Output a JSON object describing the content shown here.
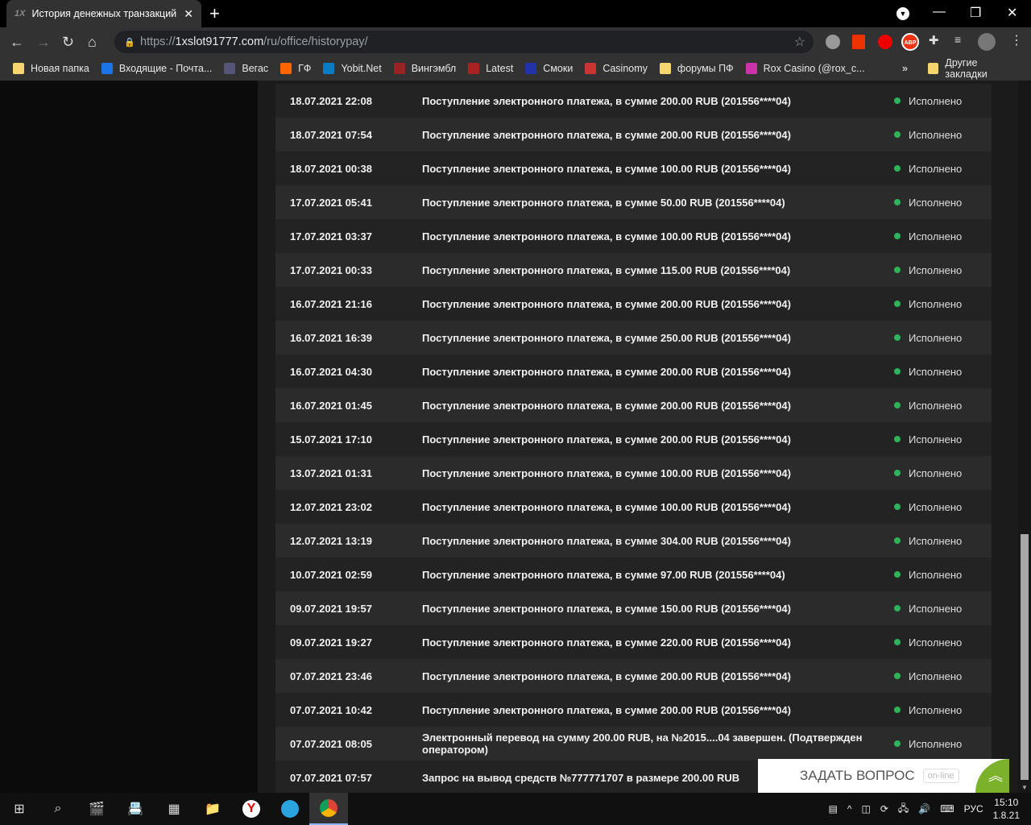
{
  "browser": {
    "tab_title": "История денежных транзакций",
    "tab_favicon": "1X",
    "url_prefix": "https://",
    "url_host": "1xslot91777.com",
    "url_path": "/ru/office/historypay/",
    "bookmarks": [
      "Новая папка",
      "Входящие - Почта...",
      "Вегас",
      "ГФ",
      "Yobit.Net",
      "Вингэмбл",
      "Latest",
      "Смоки",
      "Casinomy",
      "форумы ПФ",
      "Rox Casino (@rox_c..."
    ],
    "bookmark_overflow": "»",
    "other_bookmarks": "Другие закладки",
    "abp": "ABP"
  },
  "transactions": [
    {
      "date": "18.07.2021 22:08",
      "text": "Поступление электронного платежа, в сумме 200.00 RUB (201556****04)",
      "status": "Исполнено"
    },
    {
      "date": "18.07.2021 07:54",
      "text": "Поступление электронного платежа, в сумме 200.00 RUB (201556****04)",
      "status": "Исполнено"
    },
    {
      "date": "18.07.2021 00:38",
      "text": "Поступление электронного платежа, в сумме 100.00 RUB (201556****04)",
      "status": "Исполнено"
    },
    {
      "date": "17.07.2021 05:41",
      "text": "Поступление электронного платежа, в сумме 50.00 RUB (201556****04)",
      "status": "Исполнено"
    },
    {
      "date": "17.07.2021 03:37",
      "text": "Поступление электронного платежа, в сумме 100.00 RUB (201556****04)",
      "status": "Исполнено"
    },
    {
      "date": "17.07.2021 00:33",
      "text": "Поступление электронного платежа, в сумме 115.00 RUB (201556****04)",
      "status": "Исполнено"
    },
    {
      "date": "16.07.2021 21:16",
      "text": "Поступление электронного платежа, в сумме 200.00 RUB (201556****04)",
      "status": "Исполнено"
    },
    {
      "date": "16.07.2021 16:39",
      "text": "Поступление электронного платежа, в сумме 250.00 RUB (201556****04)",
      "status": "Исполнено"
    },
    {
      "date": "16.07.2021 04:30",
      "text": "Поступление электронного платежа, в сумме 200.00 RUB (201556****04)",
      "status": "Исполнено"
    },
    {
      "date": "16.07.2021 01:45",
      "text": "Поступление электронного платежа, в сумме 200.00 RUB (201556****04)",
      "status": "Исполнено"
    },
    {
      "date": "15.07.2021 17:10",
      "text": "Поступление электронного платежа, в сумме 200.00 RUB (201556****04)",
      "status": "Исполнено"
    },
    {
      "date": "13.07.2021 01:31",
      "text": "Поступление электронного платежа, в сумме 100.00 RUB (201556****04)",
      "status": "Исполнено"
    },
    {
      "date": "12.07.2021 23:02",
      "text": "Поступление электронного платежа, в сумме 100.00 RUB (201556****04)",
      "status": "Исполнено"
    },
    {
      "date": "12.07.2021 13:19",
      "text": "Поступление электронного платежа, в сумме 304.00 RUB (201556****04)",
      "status": "Исполнено"
    },
    {
      "date": "10.07.2021 02:59",
      "text": "Поступление электронного платежа, в сумме 97.00 RUB (201556****04)",
      "status": "Исполнено"
    },
    {
      "date": "09.07.2021 19:57",
      "text": "Поступление электронного платежа, в сумме 150.00 RUB (201556****04)",
      "status": "Исполнено"
    },
    {
      "date": "09.07.2021 19:27",
      "text": "Поступление электронного платежа, в сумме 220.00 RUB (201556****04)",
      "status": "Исполнено"
    },
    {
      "date": "07.07.2021 23:46",
      "text": "Поступление электронного платежа, в сумме 200.00 RUB (201556****04)",
      "status": "Исполнено"
    },
    {
      "date": "07.07.2021 10:42",
      "text": "Поступление электронного платежа, в сумме 200.00 RUB (201556****04)",
      "status": "Исполнено"
    },
    {
      "date": "07.07.2021 08:05",
      "text": "Электронный перевод на сумму 200.00 RUB, на №2015....04 завершен. (Подтвержден оператором)",
      "status": "Исполнено"
    },
    {
      "date": "07.07.2021 07:57",
      "text": "Запрос на вывод средств №777771707 в размере 200.00 RUB",
      "status": ""
    }
  ],
  "chat": {
    "label": "ЗАДАТЬ ВОПРОС",
    "badge": "on-line"
  },
  "taskbar": {
    "lang": "РУС",
    "time": "15:10",
    "date": "1.8.21"
  },
  "colors": {
    "status_ok": "#2fb35a",
    "chat_accent": "#7bb12b"
  }
}
